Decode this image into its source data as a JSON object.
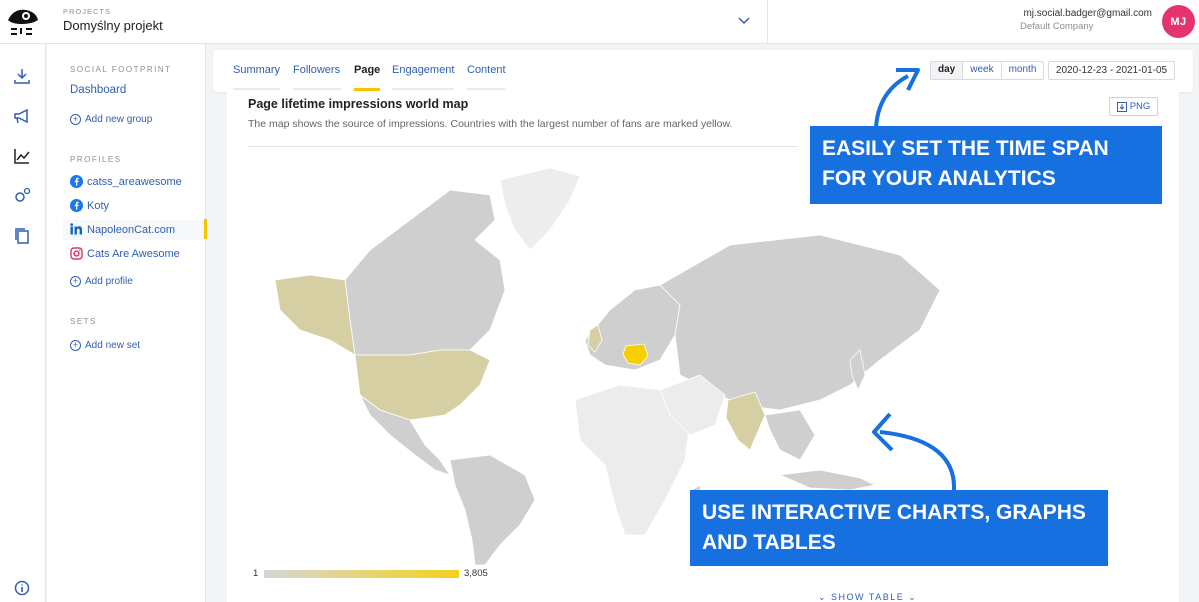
{
  "header": {
    "projects_label": "PROJECTS",
    "project_name": "Domyślny projekt",
    "user_email": "mj.social.badger@gmail.com",
    "user_company": "Default Company",
    "avatar_initials": "MJ",
    "avatar_color": "#e5336e"
  },
  "rail": {
    "icons": [
      "download-icon",
      "megaphone-icon",
      "line-chart-icon",
      "gear-cogs-icon",
      "copy-icon",
      "info-icon"
    ]
  },
  "sidebar": {
    "social_footprint_heading": "SOCIAL FOOTPRINT",
    "dashboard_link": "Dashboard",
    "add_group": "Add new group",
    "profiles_heading": "PROFILES",
    "profiles": [
      {
        "name": "catss_areawesome",
        "network": "facebook"
      },
      {
        "name": "Koty",
        "network": "facebook"
      },
      {
        "name": "NapoleonCat.com",
        "network": "linkedin"
      },
      {
        "name": "Cats Are Awesome",
        "network": "instagram"
      }
    ],
    "add_profile": "Add profile",
    "sets_heading": "SETS",
    "add_set": "Add new set"
  },
  "tabs": [
    {
      "label": "Summary"
    },
    {
      "label": "Followers"
    },
    {
      "label": "Page"
    },
    {
      "label": "Engagement"
    },
    {
      "label": "Content"
    }
  ],
  "active_tab": "Page",
  "timespan": {
    "options": [
      "day",
      "week",
      "month"
    ],
    "selected": "day",
    "date_range": "2020-12-23 - 2021-01-05"
  },
  "card": {
    "title": "Page lifetime impressions world map",
    "subtitle": "The map shows the source of impressions. Countries with the largest number of fans are marked yellow.",
    "png_button": "PNG",
    "legend_min": "1",
    "legend_max": "3,805",
    "show_table": "SHOW TABLE"
  },
  "callouts": {
    "timespan": "EASILY SET THE TIME SPAN FOR YOUR ANALYTICS",
    "charts": "USE INTERACTIVE CHARTS, GRAPHS AND TABLES"
  },
  "colors": {
    "accent_blue": "#2f5fb3",
    "highlight_yellow": "#f5c400",
    "callout_blue": "#1670e0",
    "map_gray": "#cfcfcf",
    "map_mid": "#d6cfa3"
  }
}
